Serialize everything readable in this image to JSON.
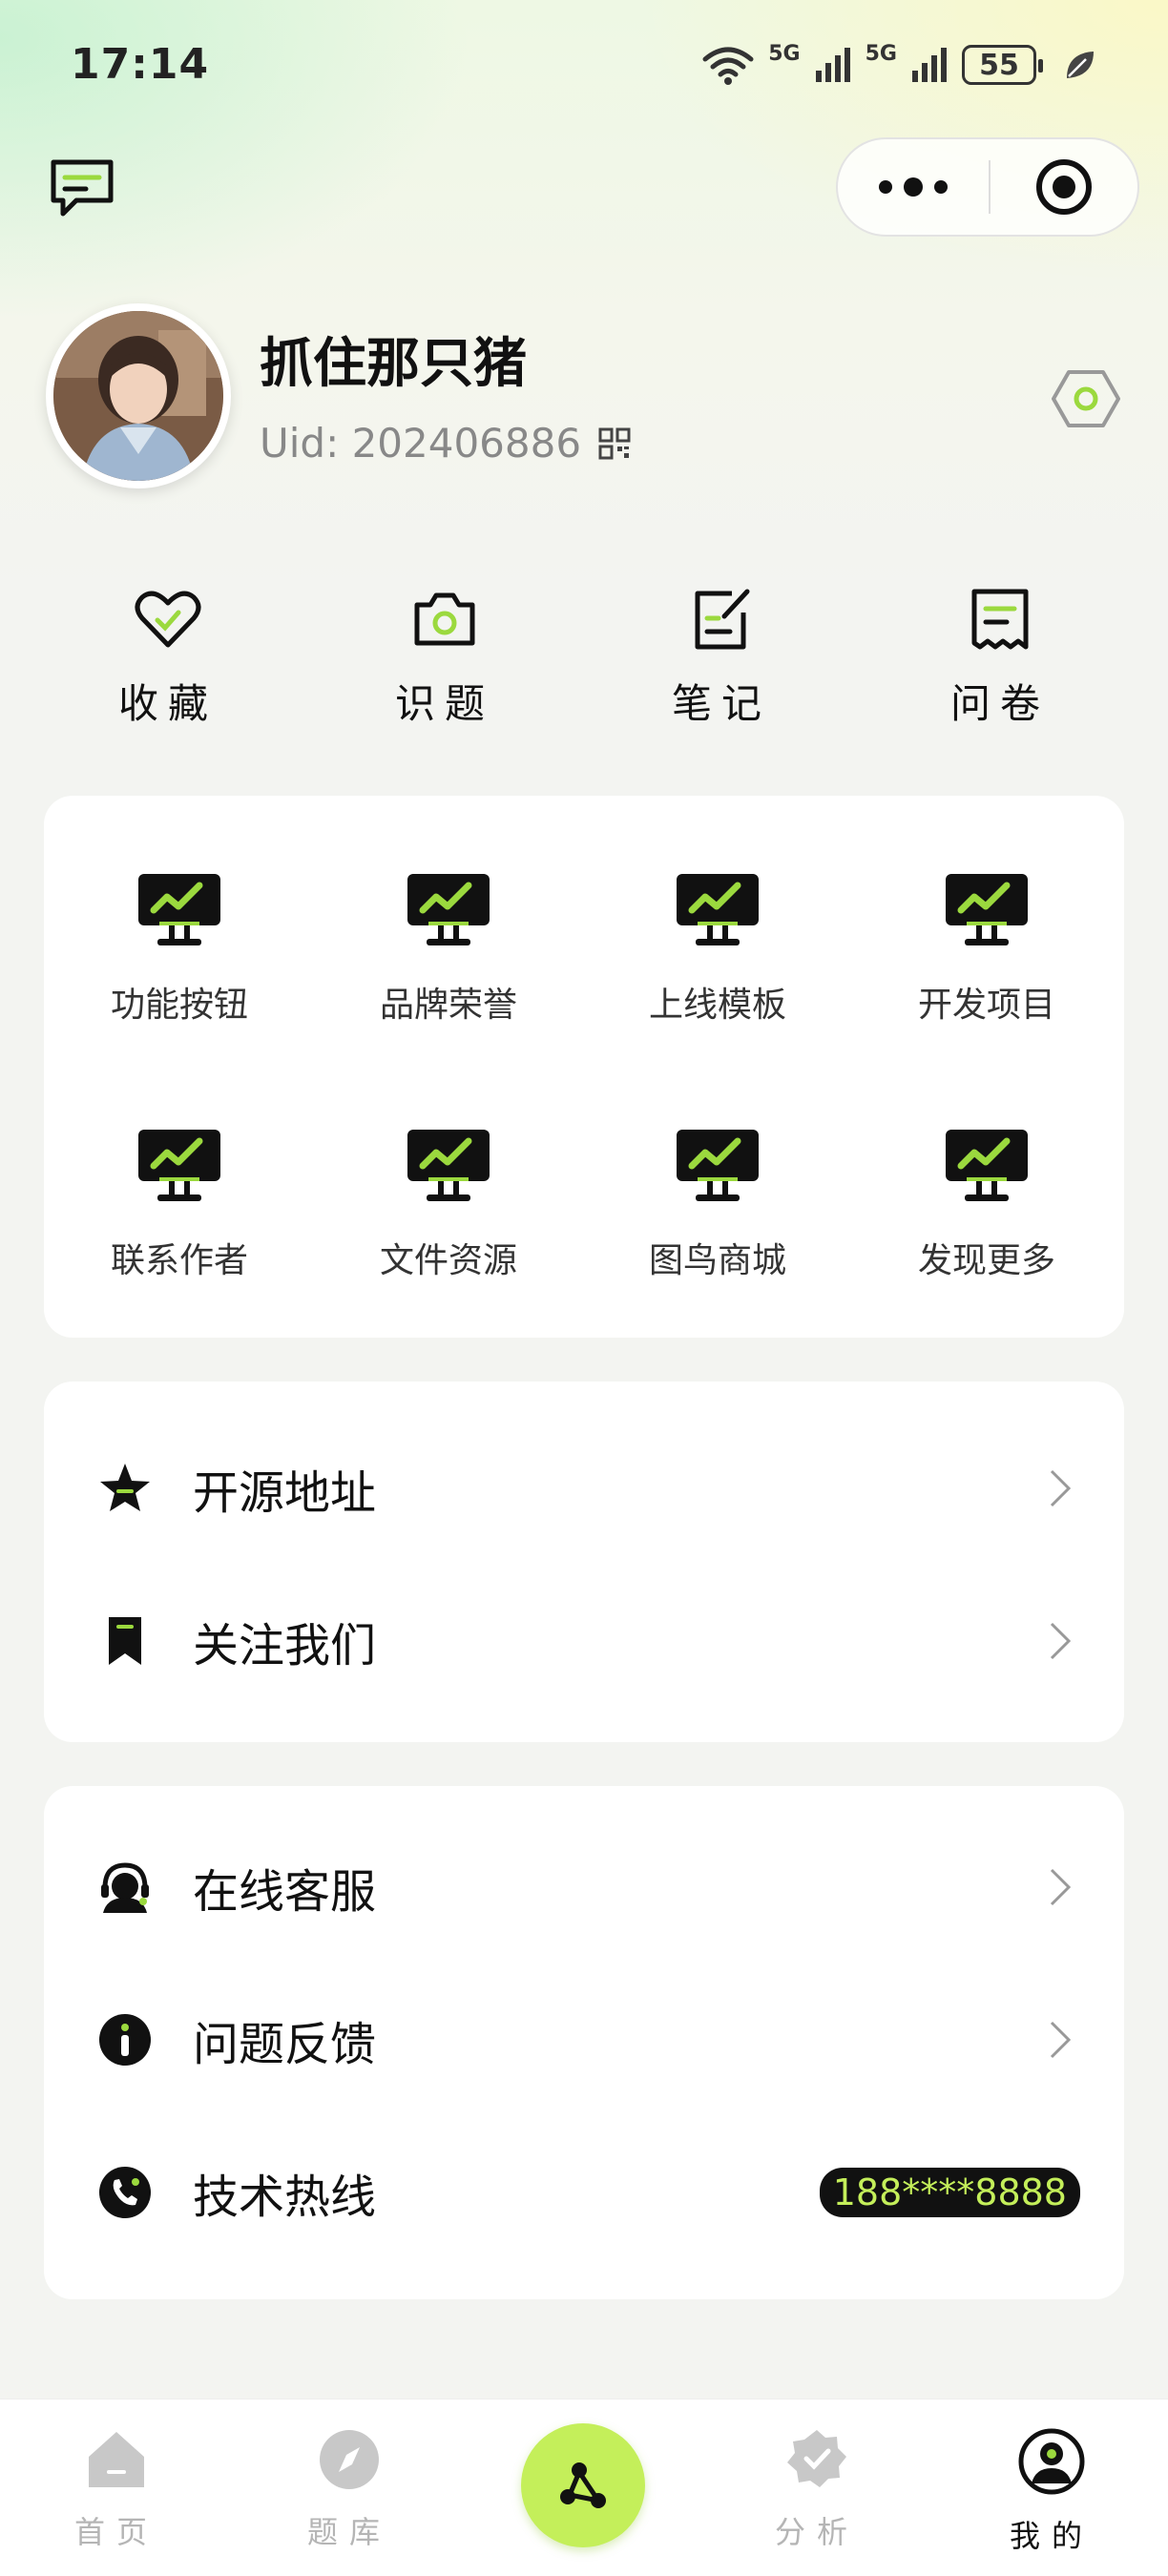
{
  "status_bar": {
    "time": "17:14",
    "battery": "55",
    "net1": "5G",
    "net2": "5G"
  },
  "profile": {
    "username": "抓住那只猪",
    "uid": "Uid: 202406886"
  },
  "quick_actions": [
    {
      "label": "收藏",
      "icon": "heart-icon"
    },
    {
      "label": "识题",
      "icon": "camera-icon"
    },
    {
      "label": "笔记",
      "icon": "note-edit-icon"
    },
    {
      "label": "问卷",
      "icon": "receipt-icon"
    }
  ],
  "grid": [
    {
      "label": "功能按钮"
    },
    {
      "label": "品牌荣誉"
    },
    {
      "label": "上线模板"
    },
    {
      "label": "开发项目"
    },
    {
      "label": "联系作者"
    },
    {
      "label": "文件资源"
    },
    {
      "label": "图鸟商城"
    },
    {
      "label": "发现更多"
    }
  ],
  "menu_group_1": [
    {
      "label": "开源地址",
      "icon": "star-icon"
    },
    {
      "label": "关注我们",
      "icon": "bookmark-icon"
    }
  ],
  "menu_group_2": [
    {
      "label": "在线客服",
      "icon": "headset-icon"
    },
    {
      "label": "问题反馈",
      "icon": "info-icon"
    },
    {
      "label": "技术热线",
      "icon": "phone-icon",
      "value": "188****8888"
    }
  ],
  "tabbar": [
    {
      "label": "首页",
      "icon": "home-icon"
    },
    {
      "label": "题库",
      "icon": "compass-icon"
    },
    {
      "label": "",
      "icon": "share-icon"
    },
    {
      "label": "分析",
      "icon": "badge-check-icon"
    },
    {
      "label": "我的",
      "icon": "user-icon",
      "active": true
    }
  ],
  "colors": {
    "accent": "#c4ef5a",
    "text": "#111111",
    "muted": "#888888"
  }
}
